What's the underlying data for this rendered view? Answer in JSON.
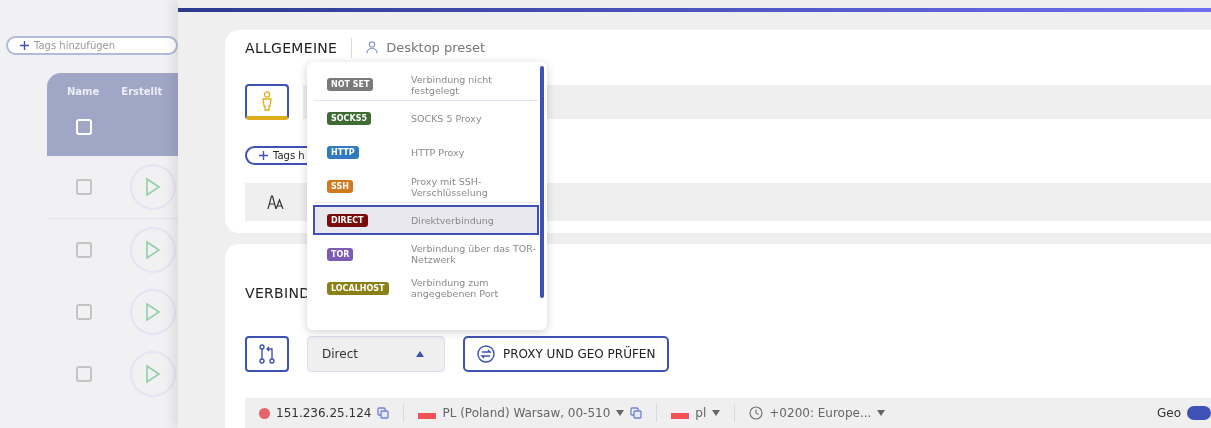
{
  "list": {
    "tags_button": "Tags hinzufügen",
    "columns": [
      "Name",
      "Erstellt"
    ],
    "header_checked": false,
    "rows": [
      {
        "checked": false
      },
      {
        "checked": false
      },
      {
        "checked": false
      },
      {
        "checked": false
      }
    ]
  },
  "general": {
    "title": "ALLGEMEINE",
    "preset": "Desktop preset",
    "avatar_selected": true,
    "tags_button": "Tags h"
  },
  "connection": {
    "title": "VERBIND",
    "type_value": "Direct",
    "dropdown_open": true,
    "check_button": "PROXY UND GEO PRÜFEN",
    "status": {
      "ip": "151.236.25.124",
      "location": "PL (Poland) Warsaw, 00-510",
      "language": "pl",
      "timezone": "+0200: Europe...",
      "geo_label": "Geo",
      "geo_on": true
    }
  },
  "dropdown": {
    "options": [
      {
        "badge": "NOT SET",
        "color": "#7a7a7a",
        "description": "Verbindung nicht festgelegt",
        "selected": false
      },
      {
        "badge": "SOCKS5",
        "color": "#3f6b35",
        "description": "SOCKS 5 Proxy",
        "selected": false
      },
      {
        "badge": "HTTP",
        "color": "#2f7bbd",
        "description": "HTTP Proxy",
        "selected": false
      },
      {
        "badge": "SSH",
        "color": "#d07a1f",
        "description": "Proxy mit SSH-Verschlüsselung",
        "selected": false
      },
      {
        "badge": "DIRECT",
        "color": "#7a0b0b",
        "description": "Direktverbindung",
        "selected": true
      },
      {
        "badge": "TOR",
        "color": "#7b5bb5",
        "description": "Verbindung über das TOR-Netzwerk",
        "selected": false
      },
      {
        "badge": "LOCALHOST",
        "color": "#8a8015",
        "description": "Verbindung zum angegebenen Port",
        "selected": false
      }
    ]
  }
}
